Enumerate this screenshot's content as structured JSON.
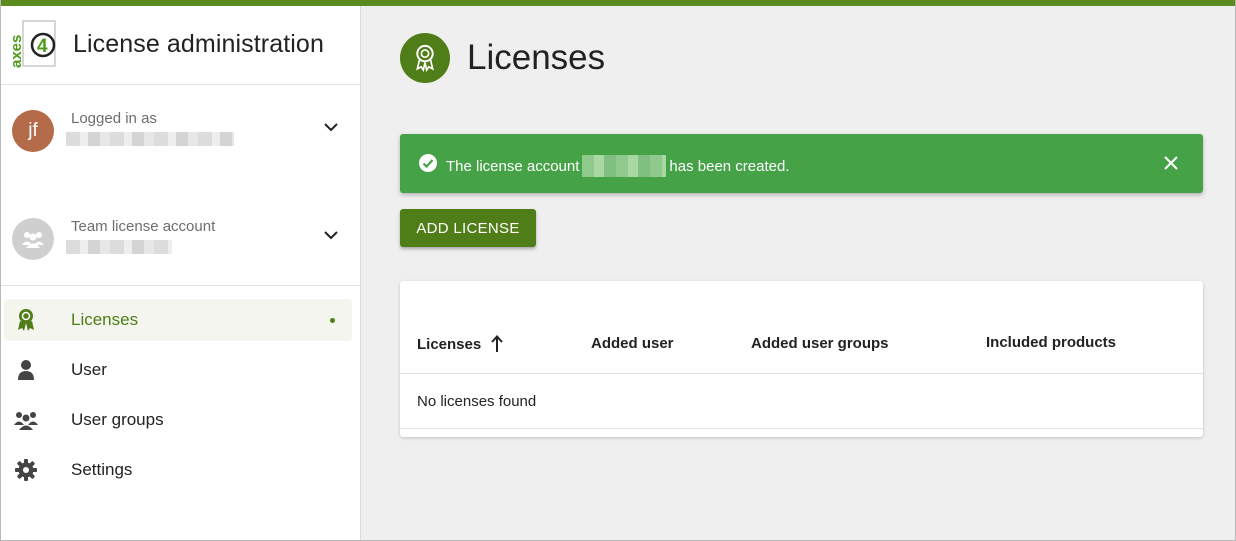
{
  "brand": {
    "logo_text": "axes",
    "logo_digit": "4",
    "app_title": "License administration"
  },
  "account": {
    "logged_in_label": "Logged in as",
    "user_initials": "jf",
    "team_label": "Team license account"
  },
  "nav": {
    "items": [
      {
        "label": "Licenses",
        "icon": "award-icon",
        "active": true
      },
      {
        "label": "User",
        "icon": "user-icon",
        "active": false
      },
      {
        "label": "User groups",
        "icon": "user-groups-icon",
        "active": false
      },
      {
        "label": "Settings",
        "icon": "gear-icon",
        "active": false
      }
    ]
  },
  "page": {
    "title": "Licenses"
  },
  "alert": {
    "text_before": "The license account",
    "text_after": "has been created."
  },
  "toolbar": {
    "add_label": "ADD LICENSE"
  },
  "table": {
    "columns": [
      "Licenses",
      "Added user",
      "Added user groups",
      "Included products"
    ],
    "empty_text": "No licenses found"
  },
  "colors": {
    "brand_green": "#4f7d17",
    "top_bar": "#5b8a1e",
    "success": "#45a247",
    "avatar": "#b36b4a"
  }
}
